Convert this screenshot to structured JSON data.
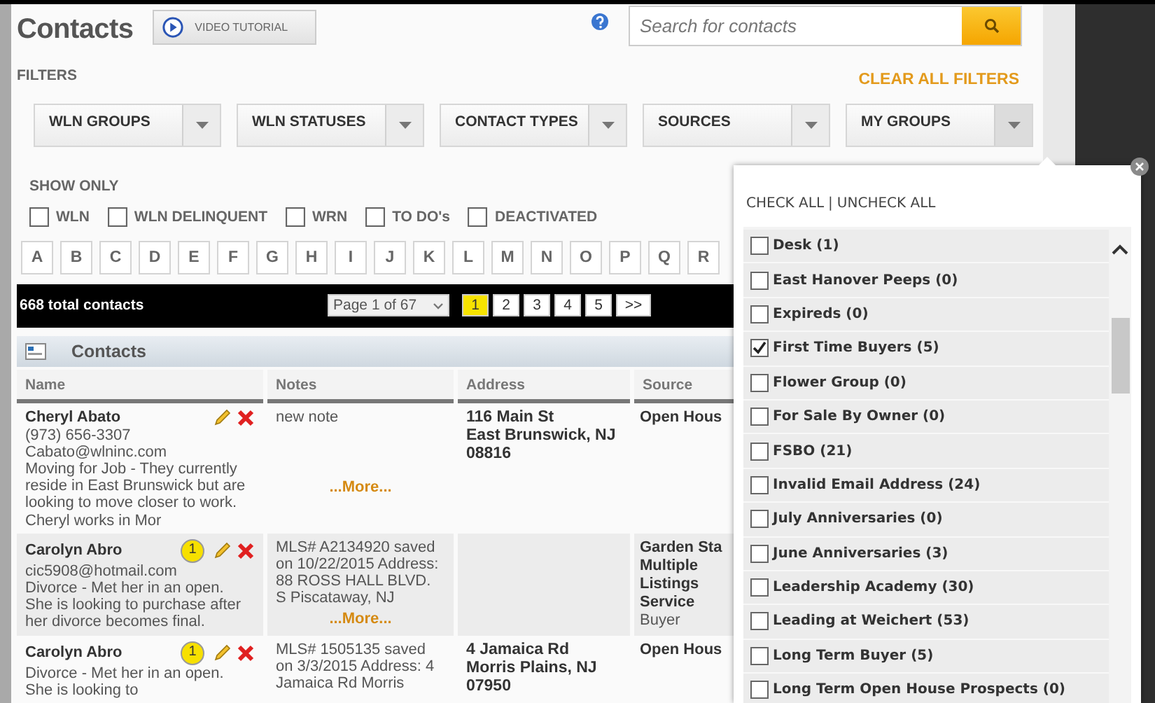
{
  "header": {
    "title": "Contacts",
    "video_button": "VIDEO TUTORIAL",
    "search": {
      "placeholder": "Search for contacts"
    }
  },
  "filters": {
    "label": "FILTERS",
    "clear_all": "CLEAR ALL FILTERS",
    "dropdowns": [
      {
        "label": "WLN GROUPS",
        "expanded": false
      },
      {
        "label": "WLN STATUSES",
        "expanded": false
      },
      {
        "label": "CONTACT TYPES",
        "expanded": false
      },
      {
        "label": "SOURCES",
        "expanded": false
      },
      {
        "label": "MY GROUPS",
        "expanded": true
      }
    ]
  },
  "show_only": {
    "label": "SHOW ONLY",
    "options": [
      {
        "label": "WLN",
        "checked": false
      },
      {
        "label": "WLN DELINQUENT",
        "checked": false
      },
      {
        "label": "WRN",
        "checked": false
      },
      {
        "label": "TO DO's",
        "checked": false
      },
      {
        "label": "DEACTIVATED",
        "checked": false
      }
    ]
  },
  "letters": [
    "A",
    "B",
    "C",
    "D",
    "E",
    "F",
    "G",
    "H",
    "I",
    "J",
    "K",
    "L",
    "M",
    "N",
    "O",
    "P",
    "Q",
    "R"
  ],
  "results": {
    "total": "668 total contacts",
    "page_select": "Page 1 of 67",
    "pages": [
      {
        "label": "1",
        "selected": true
      },
      {
        "label": "2",
        "selected": false
      },
      {
        "label": "3",
        "selected": false
      },
      {
        "label": "4",
        "selected": false
      },
      {
        "label": "5",
        "selected": false
      }
    ],
    "next": ">>"
  },
  "table": {
    "title": "Contacts",
    "columns": [
      "Name",
      "Notes",
      "Address",
      "Source"
    ],
    "rows": [
      {
        "name": "Cheryl Abato",
        "details": [
          "(973) 656-3307",
          "Cabato@wlninc.com",
          "Moving for Job - They currently reside in East Brunswick but are looking to move closer to work. Cheryl works in Mor"
        ],
        "note": "new note",
        "more": "...More...",
        "address": [
          "116 Main St",
          "East Brunswick, NJ",
          "08816"
        ],
        "source": [
          "Open Hous"
        ]
      },
      {
        "name": "Carolyn Abro",
        "badge": "1",
        "details": [
          "cic5908@hotmail.com",
          "Divorce - Met her in an open. She is looking to purchase after her divorce becomes final."
        ],
        "note": "MLS# A2134920 saved on 10/22/2015 Address: 88 ROSS HALL BLVD. S Piscataway, NJ",
        "more": "...More...",
        "source": [
          "Garden Sta",
          "Multiple",
          "Listings",
          "Service"
        ],
        "source_type": "Buyer"
      },
      {
        "name": "Carolyn Abro",
        "badge": "1",
        "details": [
          "Divorce - Met her in an open. She is looking to"
        ],
        "note": "MLS# 1505135 saved on 3/3/2015 Address: 4 Jamaica Rd Morris",
        "address": [
          "4 Jamaica Rd",
          "Morris Plains, NJ",
          "07950"
        ],
        "source": [
          "Open Hous"
        ]
      }
    ]
  },
  "groups_popup": {
    "check_all": "CHECK ALL",
    "separator": "|",
    "uncheck_all": "UNCHECK ALL",
    "groups": [
      {
        "label": "Desk (1)",
        "checked": false
      },
      {
        "label": "East Hanover Peeps (0)",
        "checked": false
      },
      {
        "label": "Expireds (0)",
        "checked": false
      },
      {
        "label": "First Time Buyers (5)",
        "checked": true
      },
      {
        "label": "Flower Group (0)",
        "checked": false
      },
      {
        "label": "For Sale By Owner (0)",
        "checked": false
      },
      {
        "label": "FSBO (21)",
        "checked": false
      },
      {
        "label": "Invalid Email Address (24)",
        "checked": false
      },
      {
        "label": "July Anniversaries (0)",
        "checked": false
      },
      {
        "label": "June Anniversaries (3)",
        "checked": false
      },
      {
        "label": "Leadership Academy (30)",
        "checked": false
      },
      {
        "label": "Leading at Weichert (53)",
        "checked": false
      },
      {
        "label": "Long Term Buyer (5)",
        "checked": false
      },
      {
        "label": "Long Term Open House Prospects (0)",
        "checked": false
      }
    ]
  }
}
